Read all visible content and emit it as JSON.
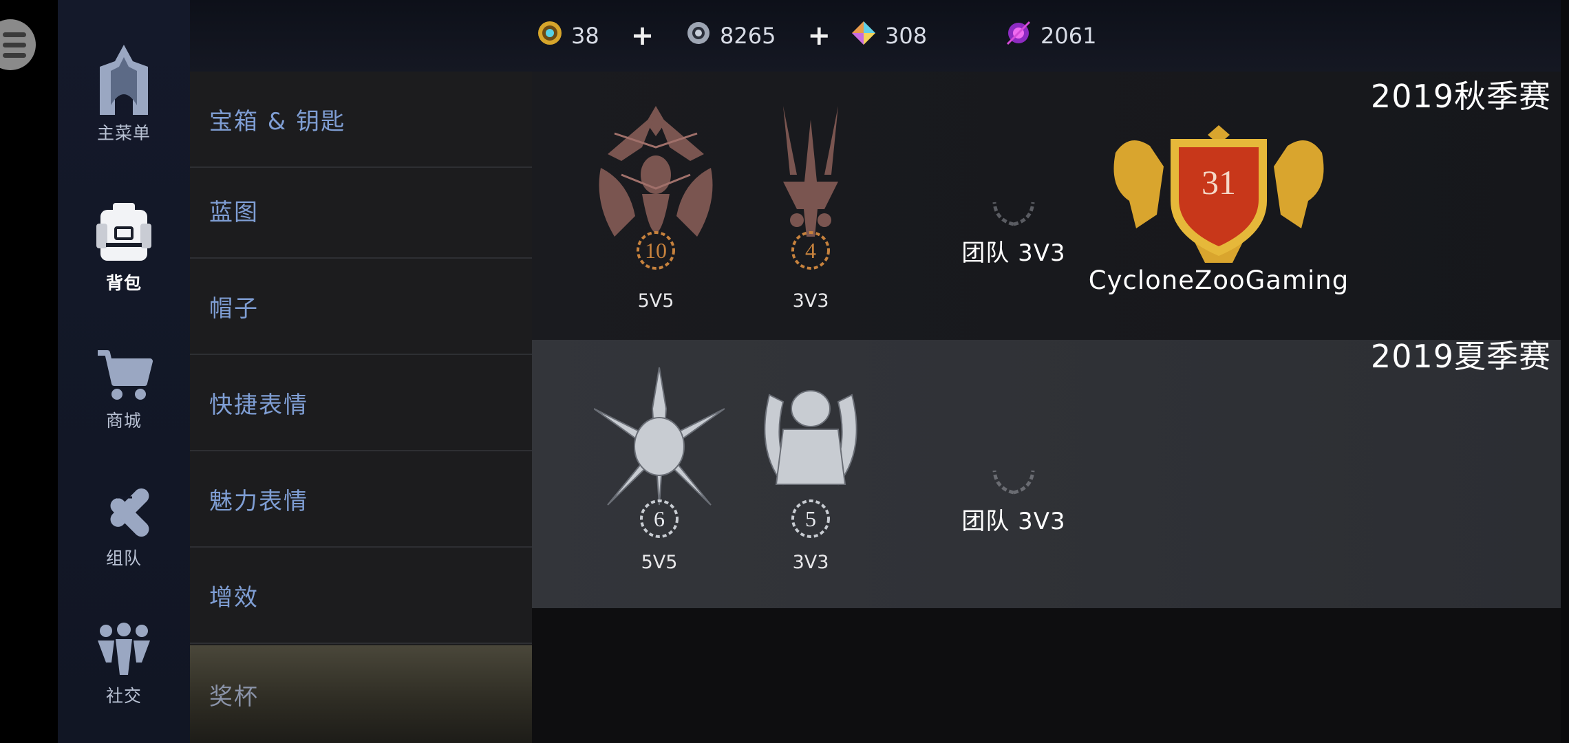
{
  "nav": {
    "items": [
      {
        "label": "主菜单",
        "icon": "temple-arch-icon"
      },
      {
        "label": "背包",
        "icon": "backpack-icon"
      },
      {
        "label": "商城",
        "icon": "shopping-cart-icon"
      },
      {
        "label": "组队",
        "icon": "team-handshake-icon"
      },
      {
        "label": "社交",
        "icon": "social-group-icon"
      }
    ],
    "active": "背包"
  },
  "categories": [
    {
      "label": "宝箱 & 钥匙"
    },
    {
      "label": "蓝图"
    },
    {
      "label": "帽子"
    },
    {
      "label": "快捷表情"
    },
    {
      "label": "魅力表情"
    },
    {
      "label": "增效"
    },
    {
      "label": "奖杯"
    }
  ],
  "currency": [
    {
      "value": "38",
      "icon": "gold-coin-icon",
      "addable": true
    },
    {
      "value": "8265",
      "icon": "silver-gear-icon",
      "addable": true
    },
    {
      "value": "308",
      "icon": "rainbow-gem-icon",
      "addable": false
    },
    {
      "value": "2061",
      "icon": "purple-orb-icon",
      "addable": false
    }
  ],
  "currency_plus": "+",
  "seasons": [
    {
      "title": "2019秋季赛",
      "badges": [
        {
          "mode": "5V5",
          "rank": "10"
        },
        {
          "mode": "3V3",
          "rank": "4"
        }
      ],
      "team_label": "团队 3V3",
      "clan": {
        "name": "CycloneZooGaming",
        "rank": "31"
      }
    },
    {
      "title": "2019夏季赛",
      "badges": [
        {
          "mode": "5V5",
          "rank": "6"
        },
        {
          "mode": "3V3",
          "rank": "5"
        }
      ],
      "team_label": "团队 3V3"
    }
  ],
  "colors": {
    "accent_blue": "#7f9ed4",
    "bronze": "#b07a3a",
    "gold": "#e0b23a",
    "crest_red": "#c8371a"
  }
}
